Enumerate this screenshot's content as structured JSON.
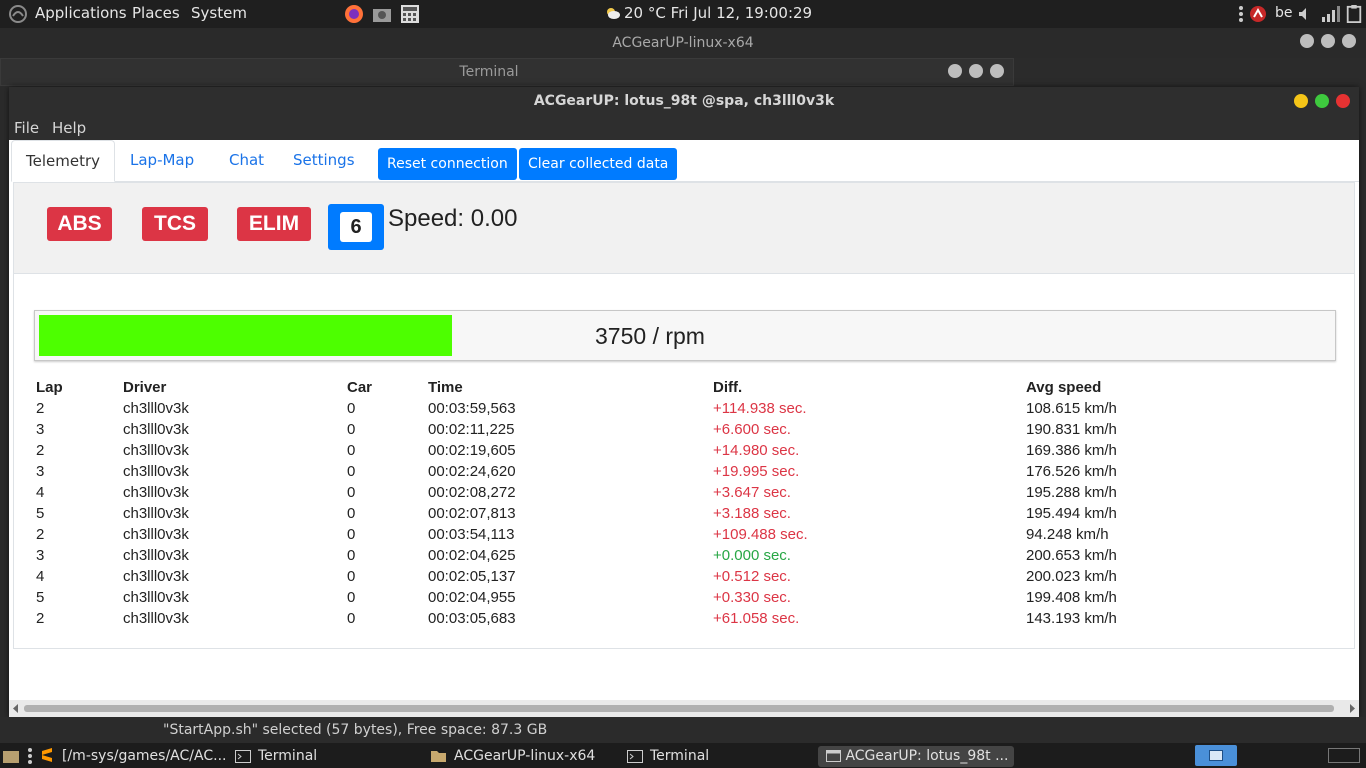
{
  "top_panel": {
    "menus": [
      "Applications",
      "Places",
      "System"
    ],
    "clock": "20 °C Fri Jul 12, 19:00:29",
    "keyboard_layout": "be"
  },
  "background_windows": {
    "filemanager_title": "ACGearUP-linux-x64",
    "terminal_title": "Terminal"
  },
  "main_window": {
    "title": "ACGearUP: lotus_98t @spa, ch3lll0v3k",
    "menu": [
      "File",
      "Help"
    ],
    "tabs": [
      "Telemetry",
      "Lap-Map",
      "Chat",
      "Settings"
    ],
    "buttons": {
      "reset": "Reset connection",
      "clear": "Clear collected data"
    },
    "indicators": {
      "abs": "ABS",
      "tcs": "TCS",
      "elim": "ELIM"
    },
    "gear": "6",
    "speed": "Speed: 0.00",
    "rpm": {
      "text": "3750 / rpm",
      "fill_fraction": 0.32
    },
    "table": {
      "headers": [
        "Lap",
        "Driver",
        "Car",
        "Time",
        "Diff.",
        "Avg speed"
      ],
      "rows": [
        [
          "2",
          "ch3lll0v3k",
          "0",
          "00:03:59,563",
          "+114.938 sec.",
          "108.615 km/h"
        ],
        [
          "3",
          "ch3lll0v3k",
          "0",
          "00:02:11,225",
          "+6.600 sec.",
          "190.831 km/h"
        ],
        [
          "2",
          "ch3lll0v3k",
          "0",
          "00:02:19,605",
          "+14.980 sec.",
          "169.386 km/h"
        ],
        [
          "3",
          "ch3lll0v3k",
          "0",
          "00:02:24,620",
          "+19.995 sec.",
          "176.526 km/h"
        ],
        [
          "4",
          "ch3lll0v3k",
          "0",
          "00:02:08,272",
          "+3.647 sec.",
          "195.288 km/h"
        ],
        [
          "5",
          "ch3lll0v3k",
          "0",
          "00:02:07,813",
          "+3.188 sec.",
          "195.494 km/h"
        ],
        [
          "2",
          "ch3lll0v3k",
          "0",
          "00:03:54,113",
          "+109.488 sec.",
          "94.248 km/h"
        ],
        [
          "3",
          "ch3lll0v3k",
          "0",
          "00:02:04,625",
          "+0.000 sec.",
          "200.653 km/h"
        ],
        [
          "4",
          "ch3lll0v3k",
          "0",
          "00:02:05,137",
          "+0.512 sec.",
          "200.023 km/h"
        ],
        [
          "5",
          "ch3lll0v3k",
          "0",
          "00:02:04,955",
          "+0.330 sec.",
          "199.408 km/h"
        ],
        [
          "2",
          "ch3lll0v3k",
          "0",
          "00:03:05,683",
          "+61.058 sec.",
          "143.193 km/h"
        ]
      ]
    }
  },
  "statusbar": {
    "text": "\"StartApp.sh\" selected (57 bytes), Free space: 87.3 GB"
  },
  "taskbar": {
    "tasks": [
      "[/m-sys/games/AC/AC...",
      "Terminal",
      "ACGearUP-linux-x64",
      "Terminal",
      "ACGearUP: lotus_98t ..."
    ]
  },
  "colors": {
    "accent": "#007bff",
    "danger": "#dc3545",
    "success": "#28a745",
    "rpm_fill": "#4dff00"
  }
}
